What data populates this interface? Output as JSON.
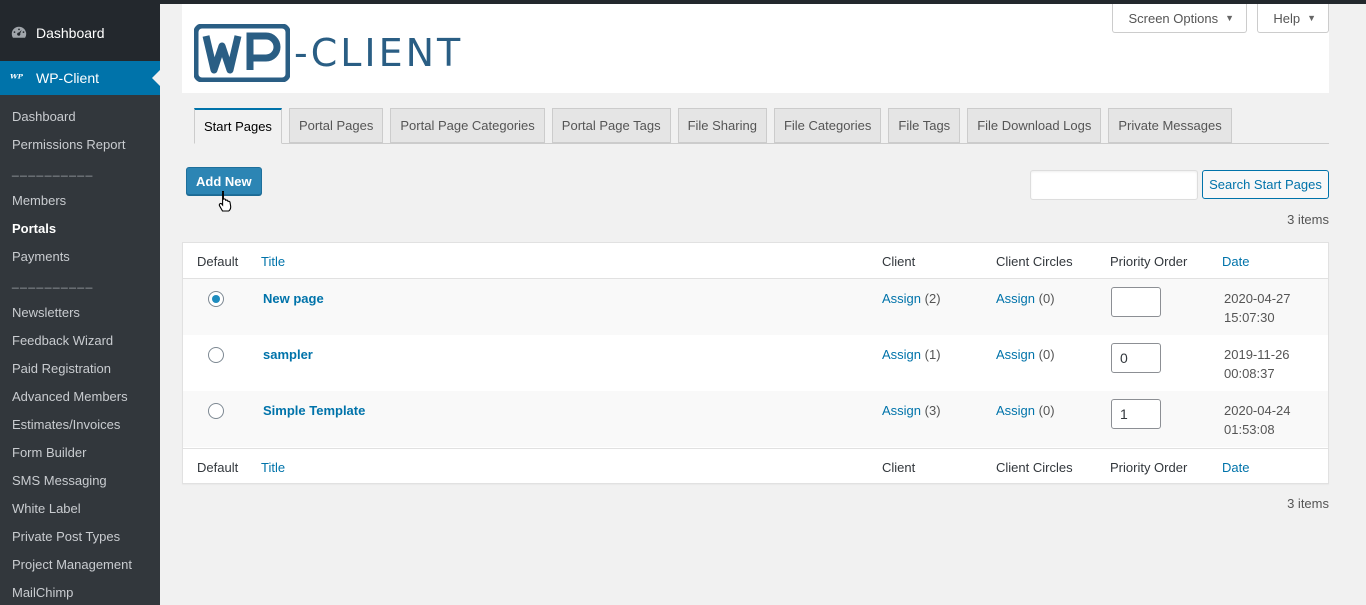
{
  "sidebar": {
    "dashboard_label": "Dashboard",
    "active_label": "WP-Client",
    "active_icon": "wp-client-icon",
    "submenu": [
      "Dashboard",
      "Permissions Report",
      "__________",
      "Members",
      "Portals",
      "Payments",
      "__________",
      "Newsletters",
      "Feedback Wizard",
      "Paid Registration",
      "Advanced Members",
      "Estimates/Invoices",
      "Form Builder",
      "SMS Messaging",
      "White Label",
      "Private Post Types",
      "Project Management",
      "MailChimp"
    ],
    "current_item": "Portals",
    "active_color": "#0073aa"
  },
  "header": {
    "screen_options_label": "Screen Options",
    "help_label": "Help",
    "logo_text": "-CLIENT",
    "logo_mark": "WP"
  },
  "tabs": [
    "Start Pages",
    "Portal Pages",
    "Portal Page Categories",
    "Portal Page Tags",
    "File Sharing",
    "File Categories",
    "File Tags",
    "File Download Logs",
    "Private Messages"
  ],
  "active_tab": "Start Pages",
  "actions": {
    "add_new_label": "Add New",
    "search_value": "",
    "search_button_label": "Search Start Pages"
  },
  "items_count": "3 items",
  "table": {
    "columns": {
      "default": "Default",
      "title": "Title",
      "client": "Client",
      "client_circles": "Client Circles",
      "priority_order": "Priority Order",
      "date": "Date"
    },
    "rows": [
      {
        "default": true,
        "title": "New page",
        "client_link": "Assign",
        "client_count": "(2)",
        "circles_link": "Assign",
        "circles_count": "(0)",
        "priority": "",
        "date": "2020-04-27",
        "time": "15:07:30"
      },
      {
        "default": false,
        "title": "sampler",
        "client_link": "Assign",
        "client_count": "(1)",
        "circles_link": "Assign",
        "circles_count": "(0)",
        "priority": "0",
        "date": "2019-11-26",
        "time": "00:08:37"
      },
      {
        "default": false,
        "title": "Simple Template",
        "client_link": "Assign",
        "client_count": "(3)",
        "circles_link": "Assign",
        "circles_count": "(0)",
        "priority": "1",
        "date": "2020-04-24",
        "time": "01:53:08"
      }
    ]
  }
}
